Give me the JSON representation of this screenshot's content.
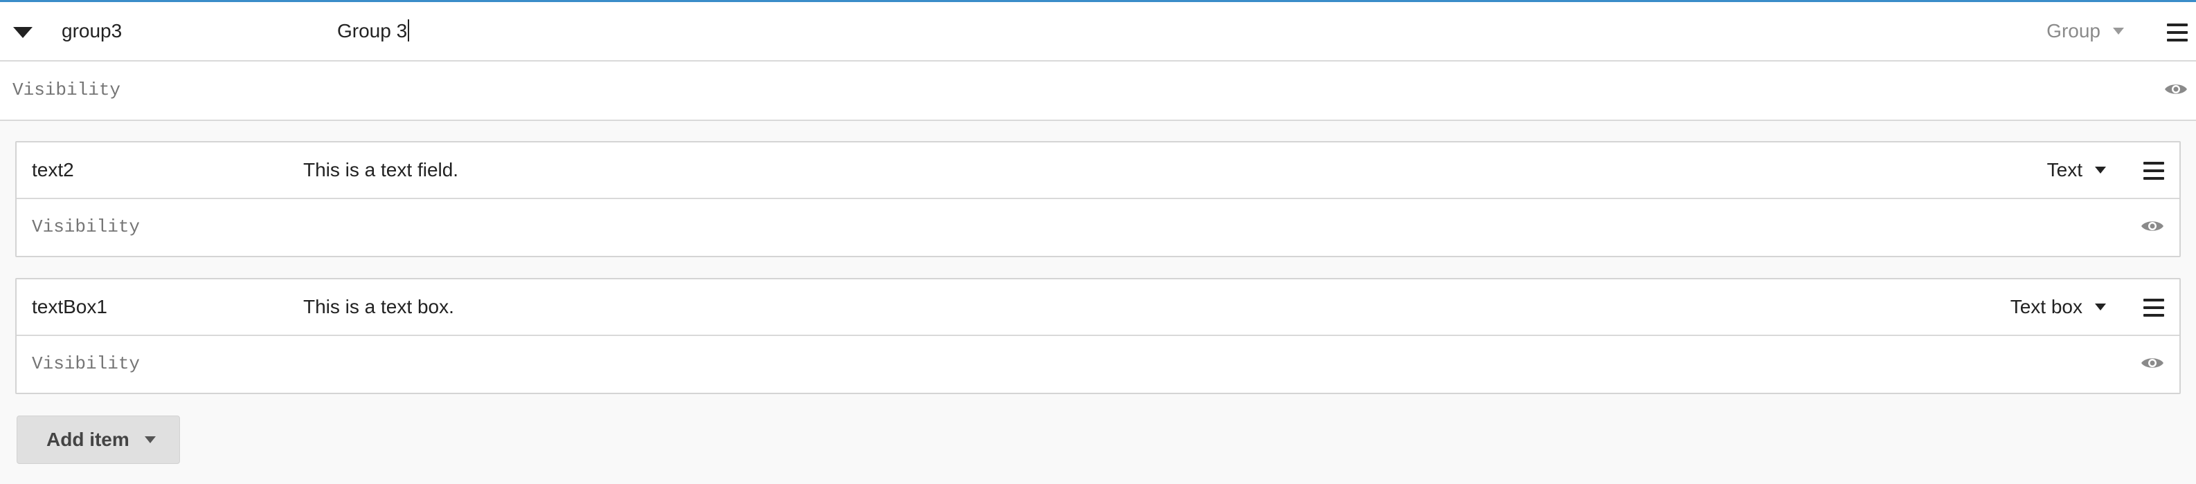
{
  "group": {
    "name": "group3",
    "label": "Group 3",
    "type": "Group",
    "visibility_placeholder": "Visibility"
  },
  "items": [
    {
      "name": "text2",
      "label": "This is a text field.",
      "type": "Text",
      "visibility_placeholder": "Visibility"
    },
    {
      "name": "textBox1",
      "label": "This is a text box.",
      "type": "Text box",
      "visibility_placeholder": "Visibility"
    }
  ],
  "add_item": {
    "label": "Add item"
  },
  "colors": {
    "accent_line": "#3a8dc9",
    "muted_text": "#a8a8a8",
    "border": "#d4d4d4",
    "button_bg": "#e0e0e0"
  },
  "icons": {
    "collapse": "caret-down-icon",
    "menu": "hamburger-menu-icon",
    "visibility": "eye-icon",
    "dropdown": "chevron-down-icon"
  }
}
